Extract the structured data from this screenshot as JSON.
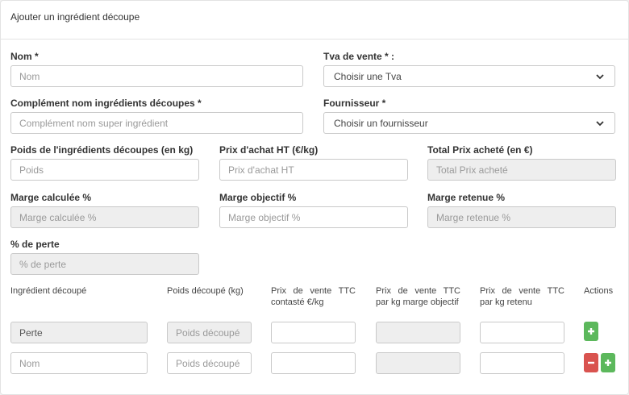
{
  "header": {
    "title": "Ajouter un ingrédient découpe"
  },
  "form": {
    "nom": {
      "label": "Nom *",
      "placeholder": "Nom"
    },
    "tva": {
      "label": "Tva de vente * :",
      "selected": "Choisir une Tva"
    },
    "complement": {
      "label": "Complément nom ingrédients découpes *",
      "placeholder": "Complément nom super ingrédient"
    },
    "fournisseur": {
      "label": "Fournisseur *",
      "selected": "Choisir un fournisseur"
    },
    "poids": {
      "label": "Poids de l'ingrédients découpes (en kg)",
      "placeholder": "Poids"
    },
    "prix_achat": {
      "label": "Prix d'achat HT (€/kg)",
      "placeholder": "Prix d'achat HT"
    },
    "total_prix": {
      "label": "Total Prix acheté (en €)",
      "placeholder": "Total Prix acheté"
    },
    "marge_calculee": {
      "label": "Marge calculée %",
      "placeholder": "Marge calculée %"
    },
    "marge_objectif": {
      "label": "Marge objectif %",
      "placeholder": "Marge objectif %"
    },
    "marge_retenue": {
      "label": "Marge retenue %",
      "placeholder": "Marge retenue %"
    },
    "perte": {
      "label": "% de perte",
      "placeholder": "% de perte"
    }
  },
  "table": {
    "headers": {
      "ingredient": "Ingrédient découpé",
      "poids": "Poids découpé (kg)",
      "prix_constate": "Prix de vente TTC contasté €/kg",
      "prix_marge": "Prix de vente TTC par kg marge objectif",
      "prix_retenu": "Prix de vente TTC par kg retenu",
      "actions": "Actions"
    },
    "rows": [
      {
        "ingredient_value": "Perte",
        "ingredient_placeholder": "",
        "poids_placeholder": "Poids découpé"
      },
      {
        "ingredient_value": "",
        "ingredient_placeholder": "Nom",
        "poids_placeholder": "Poids découpé"
      }
    ]
  },
  "colors": {
    "add": "#5cb85c",
    "remove": "#d9534f",
    "readonly_bg": "#eeeeee",
    "border": "#c9c9c9"
  },
  "icons": {
    "add": "plus-icon",
    "remove": "minus-icon",
    "select": "chevron-down-icon"
  }
}
